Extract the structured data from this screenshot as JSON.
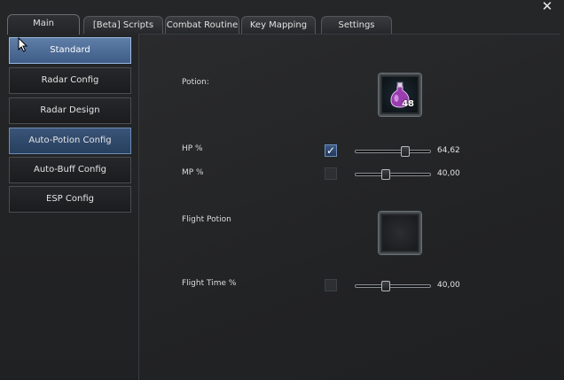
{
  "window": {
    "close_symbol": "✕"
  },
  "tabs": [
    {
      "label": "Main",
      "active": true
    },
    {
      "label": "[Beta] Scripts",
      "active": false
    },
    {
      "label": "Combat Routine",
      "active": false
    },
    {
      "label": "Key Mapping",
      "active": false
    },
    {
      "label": "Settings",
      "active": false
    }
  ],
  "sidebar": {
    "items": [
      {
        "label": "Standard",
        "state": "selected"
      },
      {
        "label": "Radar Config",
        "state": "normal"
      },
      {
        "label": "Radar Design",
        "state": "normal"
      },
      {
        "label": "Auto-Potion Config",
        "state": "highlight"
      },
      {
        "label": "Auto-Buff Config",
        "state": "normal"
      },
      {
        "label": "ESP Config",
        "state": "normal"
      }
    ]
  },
  "panel": {
    "potion_label": "Potion:",
    "potion_count": "48",
    "hp_label": "HP %",
    "hp_checked": true,
    "hp_value": "64,62",
    "hp_fraction": 0.6462,
    "mp_label": "MP %",
    "mp_checked": false,
    "mp_value": "40,00",
    "mp_fraction": 0.4,
    "flight_potion_label": "Flight Potion",
    "flight_time_label": "Flight Time %",
    "flight_checked": false,
    "flight_value": "40,00",
    "flight_fraction": 0.4
  },
  "colors": {
    "accent_selected": "#5f7ea8",
    "potion_liquid": "#c04fd0"
  }
}
